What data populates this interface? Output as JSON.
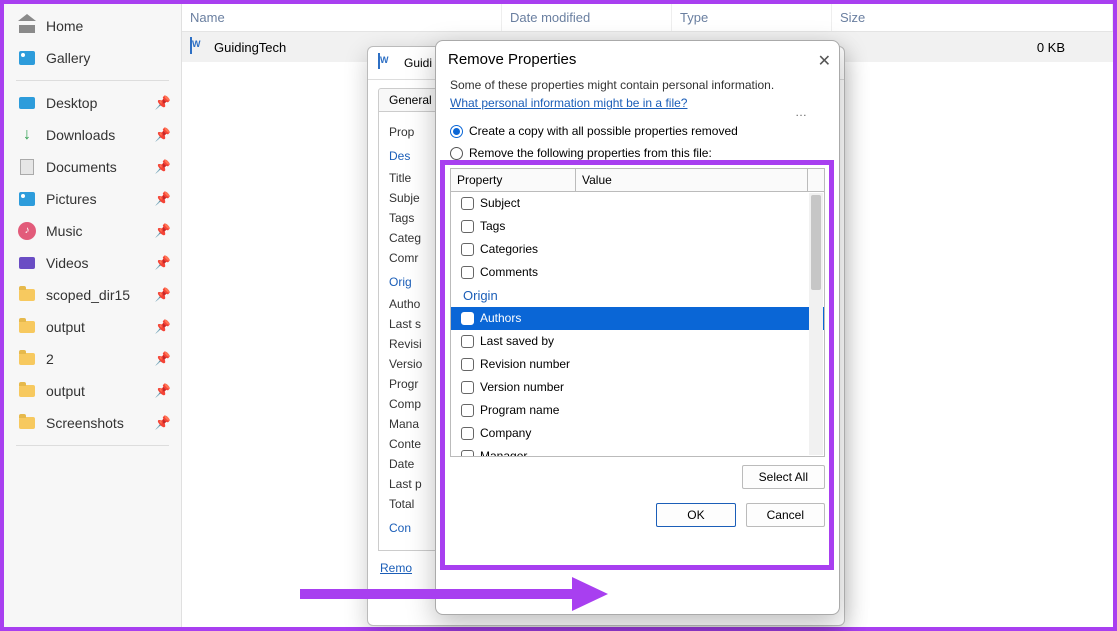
{
  "sidebar": {
    "home": "Home",
    "gallery": "Gallery",
    "desktop": "Desktop",
    "downloads": "Downloads",
    "documents": "Documents",
    "pictures": "Pictures",
    "music": "Music",
    "videos": "Videos",
    "scoped": "scoped_dir15",
    "output1": "output",
    "two": "2",
    "output2": "output",
    "screenshots": "Screenshots"
  },
  "columns": {
    "name": "Name",
    "date": "Date modified",
    "type": "Type",
    "size": "Size"
  },
  "file_row": {
    "name": "GuidingTech",
    "size": "0 KB"
  },
  "props_window": {
    "title_prefix": "Guidi",
    "tab_general": "General",
    "body_title": "Prop",
    "sect_description": "Des",
    "fields": [
      "Title",
      "Subje",
      "Tags",
      "Categ",
      "Comr"
    ],
    "sect_origin": "Orig",
    "origin_fields": [
      "Autho",
      "Last s",
      "Revisi",
      "Versio",
      "Progr",
      "Comp",
      "Mana",
      "Conte",
      "Date",
      "Last p",
      "Total"
    ],
    "sect_content": "Con",
    "remove_link": "Remo"
  },
  "dialog": {
    "title": "Remove Properties",
    "info": "Some of these properties might contain personal information.",
    "link": "What personal information might be in a file?",
    "opt_copy": "Create a copy with all possible properties removed",
    "opt_remove": "Remove the following properties from this file:",
    "head_property": "Property",
    "head_value": "Value",
    "items": {
      "subject": "Subject",
      "tags": "Tags",
      "categories": "Categories",
      "comments": "Comments",
      "sect_origin": "Origin",
      "authors": "Authors",
      "last_saved": "Last saved by",
      "revision": "Revision number",
      "version": "Version number",
      "program": "Program name",
      "company": "Company",
      "manager": "Manager"
    },
    "select_all": "Select All",
    "ok": "OK",
    "cancel": "Cancel"
  },
  "glyphs": {
    "pin": "📌",
    "down": "↓",
    "note": "♪",
    "close": "✕",
    "ellipsis": "…"
  }
}
